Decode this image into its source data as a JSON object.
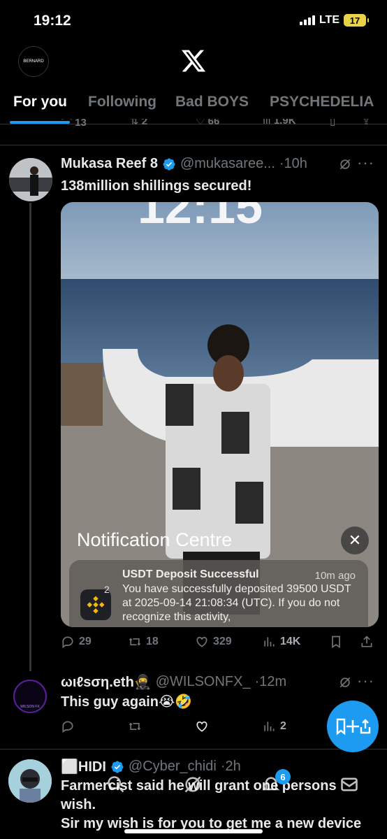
{
  "status_bar": {
    "time": "19:12",
    "network": "LTE",
    "battery": "17"
  },
  "header": {
    "avatar_text": "BERNARD",
    "logo": "x-logo-icon"
  },
  "tabs": [
    {
      "label": "For you",
      "active": true
    },
    {
      "label": "Following",
      "active": false
    },
    {
      "label": "Bad BOYS",
      "active": false
    },
    {
      "label": "PSYCHEDELIA",
      "active": false
    }
  ],
  "prev_tweet_actions": {
    "replies": "13",
    "reposts": "2",
    "likes": "66",
    "views": "1.9K"
  },
  "tweets": [
    {
      "name": "Mukasa Reef 8",
      "handle": "@mukasaree...",
      "time": "·10h",
      "text": "138million shillings secured!",
      "media": {
        "notification_centre": "Notification Centre",
        "notif_title": "USDT Deposit Successful",
        "notif_time": "10m ago",
        "notif_body": "You have successfully deposited 39500 USDT at 2025-09-14 21:08:34 (UTC). If you do not recognize this activity,",
        "notif_badge": "2"
      },
      "replies": "29",
      "reposts": "18",
      "likes": "329",
      "views": "14K"
    },
    {
      "name": "ωιℓsση.eth🥷",
      "handle": "@WILSONFX_",
      "time": "·12m",
      "text": "This guy again😭🤣",
      "avatar_text": "WILSON FX",
      "views": "2"
    },
    {
      "name": "⬜HIDI",
      "handle": "@Cyber_chidi",
      "time": "·2h",
      "text_lines": [
        "Farmercist said he will grant one persons",
        "wish.",
        "Sir my wish is for you to get me a new device"
      ]
    }
  ],
  "bottom_nav": {
    "notifications_badge": "6"
  },
  "colors": {
    "accent": "#1d9bf0",
    "muted": "#71767b",
    "background": "#000000"
  }
}
